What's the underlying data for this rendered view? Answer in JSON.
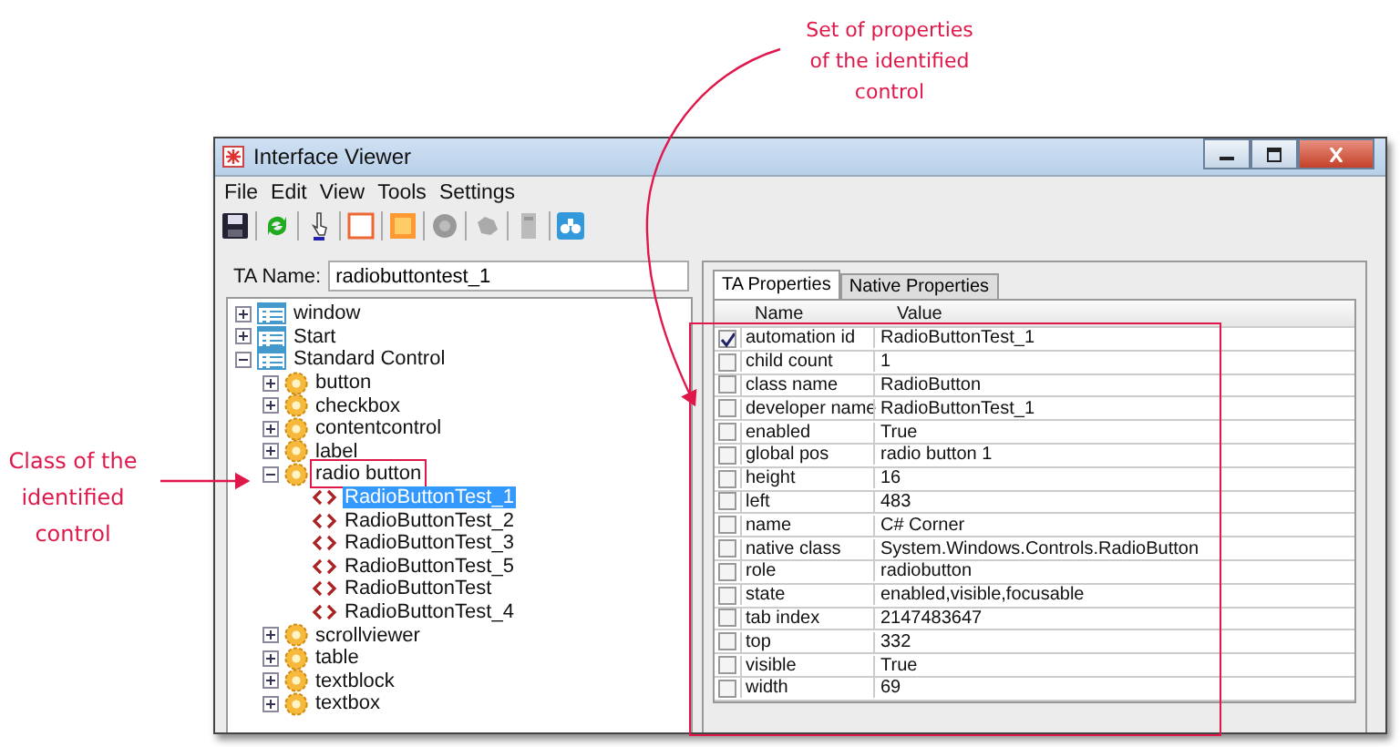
{
  "annotations": [
    {
      "text": "Set of properties\nof the identified\ncontrol"
    },
    {
      "text": "Class of the\nidentified\ncontrol"
    }
  ],
  "window": {
    "title": "Interface Viewer"
  },
  "menu": [
    "File",
    "Edit",
    "View",
    "Tools",
    "Settings"
  ],
  "ta_name": {
    "label": "TA Name:",
    "value": "radiobuttontest_1"
  },
  "tree": {
    "items": [
      {
        "label": "window",
        "kind": "list",
        "expanded": false
      },
      {
        "label": "Start",
        "kind": "list",
        "expanded": false
      },
      {
        "label": "Standard Control",
        "kind": "list",
        "expanded": true,
        "children": [
          {
            "label": "button",
            "kind": "gear",
            "expanded": false
          },
          {
            "label": "checkbox",
            "kind": "gear",
            "expanded": false
          },
          {
            "label": "contentcontrol",
            "kind": "gear",
            "expanded": false
          },
          {
            "label": "label",
            "kind": "gear",
            "expanded": false
          },
          {
            "label": "radio button",
            "kind": "gear",
            "expanded": true,
            "highlighted": true,
            "children": [
              {
                "label": "RadioButtonTest_1",
                "kind": "tag",
                "selected": true
              },
              {
                "label": "RadioButtonTest_2",
                "kind": "tag",
                "selected": false
              },
              {
                "label": "RadioButtonTest_3",
                "kind": "tag",
                "selected": false
              },
              {
                "label": "RadioButtonTest_5",
                "kind": "tag",
                "selected": false
              },
              {
                "label": "RadioButtonTest",
                "kind": "tag",
                "selected": false
              },
              {
                "label": "RadioButtonTest_4",
                "kind": "tag",
                "selected": false
              }
            ]
          },
          {
            "label": "scrollviewer",
            "kind": "gear",
            "expanded": false
          },
          {
            "label": "table",
            "kind": "gear",
            "expanded": false
          },
          {
            "label": "textblock",
            "kind": "gear",
            "expanded": false
          },
          {
            "label": "textbox",
            "kind": "gear",
            "expanded": false
          }
        ]
      }
    ]
  },
  "tabs": [
    {
      "label": "TA Properties",
      "selected": true
    },
    {
      "label": "Native Properties",
      "selected": false
    }
  ],
  "properties": {
    "columns": [
      "Name",
      "Value"
    ],
    "rows": [
      {
        "checked": true,
        "name": "automation id",
        "value": "RadioButtonTest_1"
      },
      {
        "checked": false,
        "name": "child count",
        "value": "1"
      },
      {
        "checked": false,
        "name": "class name",
        "value": "RadioButton"
      },
      {
        "checked": false,
        "name": "developer name",
        "value": "RadioButtonTest_1"
      },
      {
        "checked": false,
        "name": "enabled",
        "value": "True"
      },
      {
        "checked": false,
        "name": "global pos",
        "value": "radio button 1"
      },
      {
        "checked": false,
        "name": "height",
        "value": "16"
      },
      {
        "checked": false,
        "name": "left",
        "value": "483"
      },
      {
        "checked": false,
        "name": "name",
        "value": "C# Corner"
      },
      {
        "checked": false,
        "name": "native class",
        "value": "System.Windows.Controls.RadioButton"
      },
      {
        "checked": false,
        "name": "role",
        "value": "radiobutton"
      },
      {
        "checked": false,
        "name": "state",
        "value": "enabled,visible,focusable"
      },
      {
        "checked": false,
        "name": "tab index",
        "value": "2147483647"
      },
      {
        "checked": false,
        "name": "top",
        "value": "332"
      },
      {
        "checked": false,
        "name": "visible",
        "value": "True"
      },
      {
        "checked": false,
        "name": "width",
        "value": "69"
      }
    ]
  }
}
